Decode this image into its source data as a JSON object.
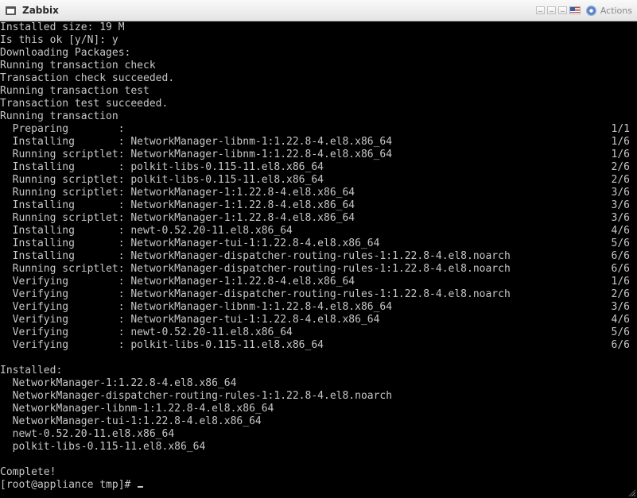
{
  "window": {
    "title": "Zabbix",
    "actions_label": "Actions"
  },
  "terminal": {
    "lines": [
      {
        "text": "Installed size: 19 M",
        "right": ""
      },
      {
        "text": "Is this ok [y/N]: y",
        "right": ""
      },
      {
        "text": "Downloading Packages:",
        "right": ""
      },
      {
        "text": "Running transaction check",
        "right": ""
      },
      {
        "text": "Transaction check succeeded.",
        "right": ""
      },
      {
        "text": "Running transaction test",
        "right": ""
      },
      {
        "text": "Transaction test succeeded.",
        "right": ""
      },
      {
        "text": "Running transaction",
        "right": ""
      },
      {
        "text": "  Preparing        :",
        "right": "1/1"
      },
      {
        "text": "  Installing       : NetworkManager-libnm-1:1.22.8-4.el8.x86_64",
        "right": "1/6"
      },
      {
        "text": "  Running scriptlet: NetworkManager-libnm-1:1.22.8-4.el8.x86_64",
        "right": "1/6"
      },
      {
        "text": "  Installing       : polkit-libs-0.115-11.el8.x86_64",
        "right": "2/6"
      },
      {
        "text": "  Running scriptlet: polkit-libs-0.115-11.el8.x86_64",
        "right": "2/6"
      },
      {
        "text": "  Running scriptlet: NetworkManager-1:1.22.8-4.el8.x86_64",
        "right": "3/6"
      },
      {
        "text": "  Installing       : NetworkManager-1:1.22.8-4.el8.x86_64",
        "right": "3/6"
      },
      {
        "text": "  Running scriptlet: NetworkManager-1:1.22.8-4.el8.x86_64",
        "right": "3/6"
      },
      {
        "text": "  Installing       : newt-0.52.20-11.el8.x86_64",
        "right": "4/6"
      },
      {
        "text": "  Installing       : NetworkManager-tui-1:1.22.8-4.el8.x86_64",
        "right": "5/6"
      },
      {
        "text": "  Installing       : NetworkManager-dispatcher-routing-rules-1:1.22.8-4.el8.noarch",
        "right": "6/6"
      },
      {
        "text": "  Running scriptlet: NetworkManager-dispatcher-routing-rules-1:1.22.8-4.el8.noarch",
        "right": "6/6"
      },
      {
        "text": "  Verifying        : NetworkManager-1:1.22.8-4.el8.x86_64",
        "right": "1/6"
      },
      {
        "text": "  Verifying        : NetworkManager-dispatcher-routing-rules-1:1.22.8-4.el8.noarch",
        "right": "2/6"
      },
      {
        "text": "  Verifying        : NetworkManager-libnm-1:1.22.8-4.el8.x86_64",
        "right": "3/6"
      },
      {
        "text": "  Verifying        : NetworkManager-tui-1:1.22.8-4.el8.x86_64",
        "right": "4/6"
      },
      {
        "text": "  Verifying        : newt-0.52.20-11.el8.x86_64",
        "right": "5/6"
      },
      {
        "text": "  Verifying        : polkit-libs-0.115-11.el8.x86_64",
        "right": "6/6"
      },
      {
        "text": "",
        "right": ""
      },
      {
        "text": "Installed:",
        "right": ""
      },
      {
        "text": "  NetworkManager-1:1.22.8-4.el8.x86_64",
        "right": ""
      },
      {
        "text": "  NetworkManager-dispatcher-routing-rules-1:1.22.8-4.el8.noarch",
        "right": ""
      },
      {
        "text": "  NetworkManager-libnm-1:1.22.8-4.el8.x86_64",
        "right": ""
      },
      {
        "text": "  NetworkManager-tui-1:1.22.8-4.el8.x86_64",
        "right": ""
      },
      {
        "text": "  newt-0.52.20-11.el8.x86_64",
        "right": ""
      },
      {
        "text": "  polkit-libs-0.115-11.el8.x86_64",
        "right": ""
      },
      {
        "text": "",
        "right": ""
      },
      {
        "text": "Complete!",
        "right": ""
      }
    ],
    "prompt": "[root@appliance tmp]# "
  }
}
